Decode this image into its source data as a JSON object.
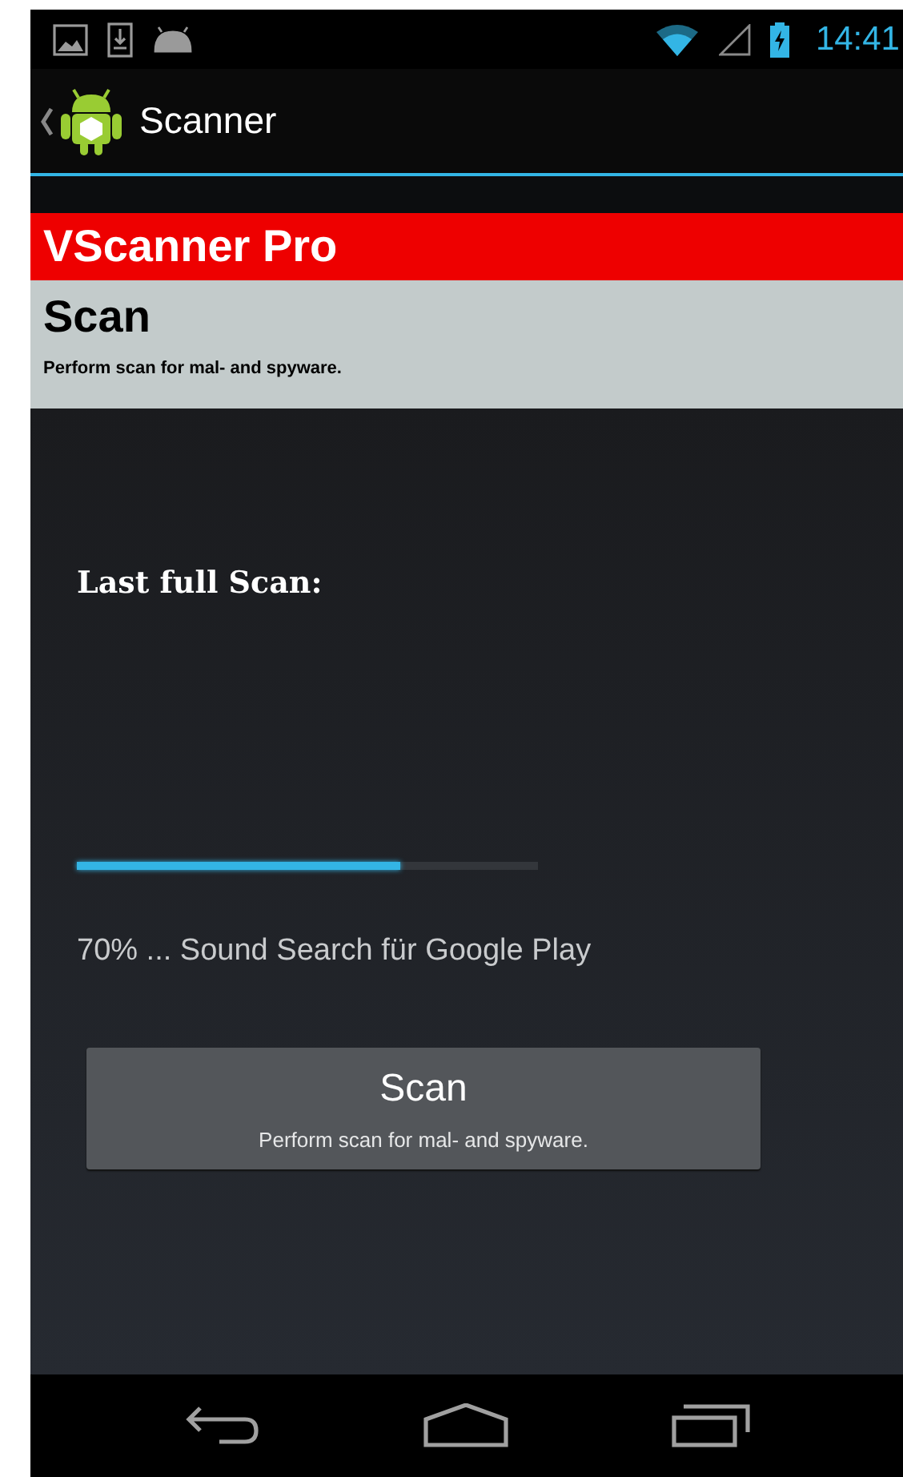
{
  "status_bar": {
    "time": "14:41"
  },
  "action_bar": {
    "title": "Scanner"
  },
  "header": {
    "app_name": "VScanner Pro",
    "title": "Scan",
    "subtitle": "Perform scan for mal- and spyware."
  },
  "last_scan": {
    "label": "Last full Scan:"
  },
  "progress": {
    "level": 0.7,
    "status": "70% ... Sound Search für Google Play"
  },
  "scan_button": {
    "label": "Scan",
    "caption": "Perform scan for mal- and spyware."
  }
}
